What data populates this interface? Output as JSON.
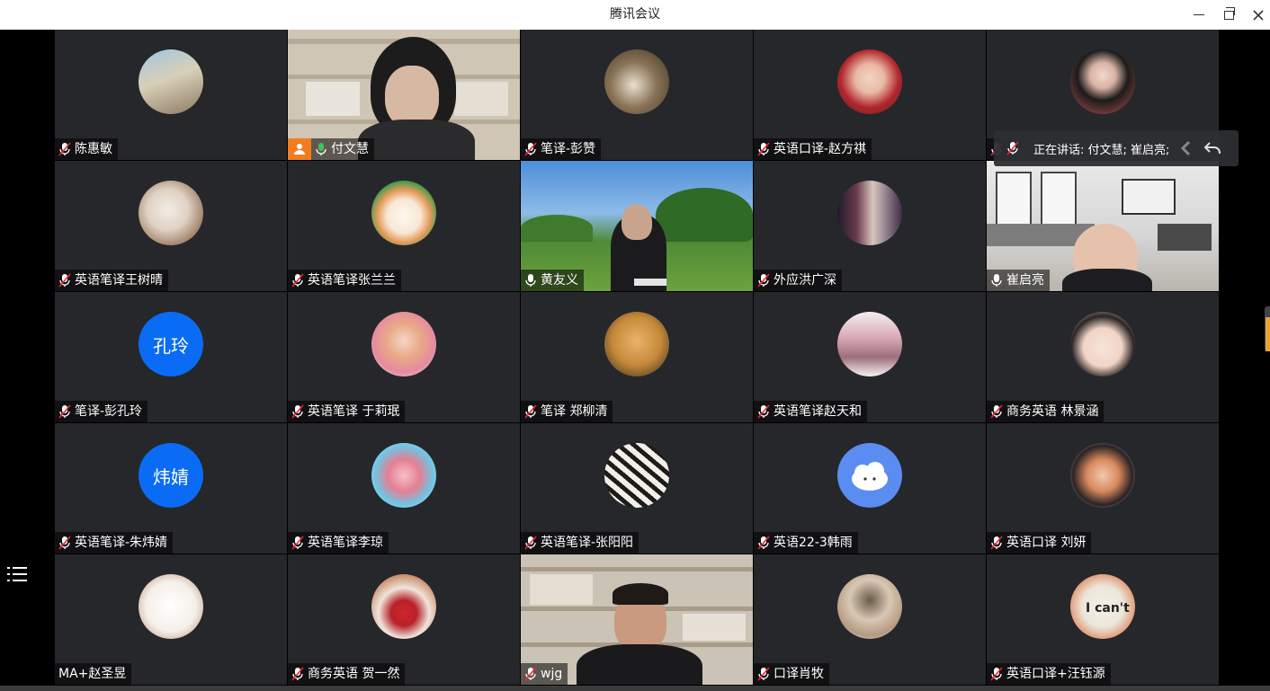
{
  "window": {
    "title": "腾讯会议"
  },
  "speaking": {
    "text": "正在讲话: 付文慧; 崔启亮;"
  },
  "colors": {
    "tile_bg": "#26272b",
    "avatar_blue": "#0a6cf5",
    "active_border": "#2aa84a",
    "camera_badge": "#f07d1f"
  },
  "participants": [
    {
      "name": "陈惠敏",
      "mic": "muted",
      "avatar": "photo-beach"
    },
    {
      "name": "付文慧",
      "mic": "active",
      "avatar": "video-woman",
      "camera_badge": true,
      "active_speaker": true
    },
    {
      "name": "笔译-彭赞",
      "mic": "muted",
      "avatar": "photo-girl-room"
    },
    {
      "name": "英语口译-赵方祺",
      "mic": "muted",
      "avatar": "photo-girl-red"
    },
    {
      "name": "",
      "mic": "muted",
      "avatar": "photo-girl-hat"
    },
    {
      "name": "英语笔译王树晴",
      "mic": "muted",
      "avatar": "photo-girl-phone"
    },
    {
      "name": "英语笔译张兰兰",
      "mic": "muted",
      "avatar": "photo-cat-cartoon"
    },
    {
      "name": "黄友义",
      "mic": "active",
      "avatar": "video-man-field"
    },
    {
      "name": "外应洪广深",
      "mic": "muted",
      "avatar": "photo-shop"
    },
    {
      "name": "崔启亮",
      "mic": "active",
      "avatar": "video-man-office"
    },
    {
      "name": "笔译-彭孔玲",
      "mic": "muted",
      "avatar_text": "孔玲"
    },
    {
      "name": "英语笔译 于莉珉",
      "mic": "muted",
      "avatar": "photo-girl-pink"
    },
    {
      "name": "笔译 郑柳清",
      "mic": "muted",
      "avatar": "photo-dog"
    },
    {
      "name": "英语笔译赵天和",
      "mic": "muted",
      "avatar": "photo-building"
    },
    {
      "name": "商务英语 林景涵",
      "mic": "muted",
      "avatar": "photo-baby"
    },
    {
      "name": "英语笔译-朱炜婧",
      "mic": "muted",
      "avatar_text": "炜婧"
    },
    {
      "name": "英语笔译李琼",
      "mic": "muted",
      "avatar": "photo-toy"
    },
    {
      "name": "英语笔译-张阳阳",
      "mic": "muted",
      "avatar": "photo-zebra"
    },
    {
      "name": "英语22-3韩雨",
      "mic": "muted",
      "avatar": "photo-cloud"
    },
    {
      "name": "英语口译 刘妍",
      "mic": "muted",
      "avatar": "photo-kid"
    },
    {
      "name": "MA+赵圣昱",
      "mic": "none",
      "avatar": "photo-sketch"
    },
    {
      "name": "商务英语 贺一然",
      "mic": "muted",
      "avatar": "photo-cat-flower"
    },
    {
      "name": "wjg",
      "mic": "muted",
      "avatar": "video-man-glasses"
    },
    {
      "name": "口译肖牧",
      "mic": "muted",
      "avatar": "photo-girl-sepia"
    },
    {
      "name": "英语口译+汪钰源",
      "mic": "muted",
      "avatar": "photo-icant"
    }
  ],
  "avatar_text_1": "孔玲",
  "avatar_text_2": "炜婧",
  "icons": {
    "list": "list-icon",
    "mic_muted": "mic-muted-icon",
    "mic_on": "mic-on-icon",
    "minimize": "minimize-icon",
    "maximize": "restore-icon",
    "close": "close-icon"
  }
}
